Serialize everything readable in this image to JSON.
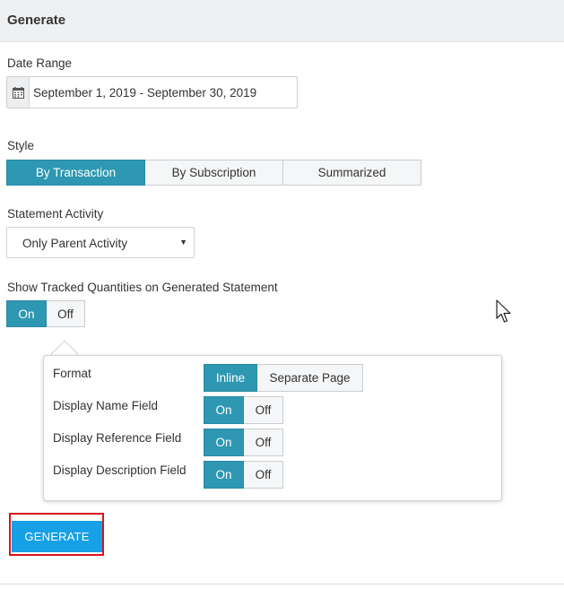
{
  "header": {
    "title": "Generate"
  },
  "date_range": {
    "label": "Date Range",
    "icon": "calendar-icon",
    "value": "September 1, 2019 - September 30, 2019"
  },
  "style": {
    "label": "Style",
    "options": [
      "By Transaction",
      "By Subscription",
      "Summarized"
    ],
    "selected": "By Transaction"
  },
  "statement_activity": {
    "label": "Statement Activity",
    "selected": "Only Parent Activity"
  },
  "tracked_quantities": {
    "label": "Show Tracked Quantities on Generated Statement",
    "on_label": "On",
    "off_label": "Off",
    "value": "On"
  },
  "popover": {
    "format": {
      "label": "Format",
      "options": [
        "Inline",
        "Separate Page"
      ],
      "selected": "Inline"
    },
    "name_field": {
      "label": "Display Name Field",
      "on_label": "On",
      "off_label": "Off",
      "value": "On"
    },
    "reference_field": {
      "label": "Display Reference Field",
      "on_label": "On",
      "off_label": "Off",
      "value": "On"
    },
    "description_field": {
      "label": "Display Description Field",
      "on_label": "On",
      "off_label": "Off",
      "value": "On"
    }
  },
  "generate_button": {
    "label": "GENERATE"
  },
  "colors": {
    "accent": "#2e97b2",
    "generate": "#16a0e5",
    "highlight": "#d8141d",
    "header_bg": "#eef0f2"
  }
}
